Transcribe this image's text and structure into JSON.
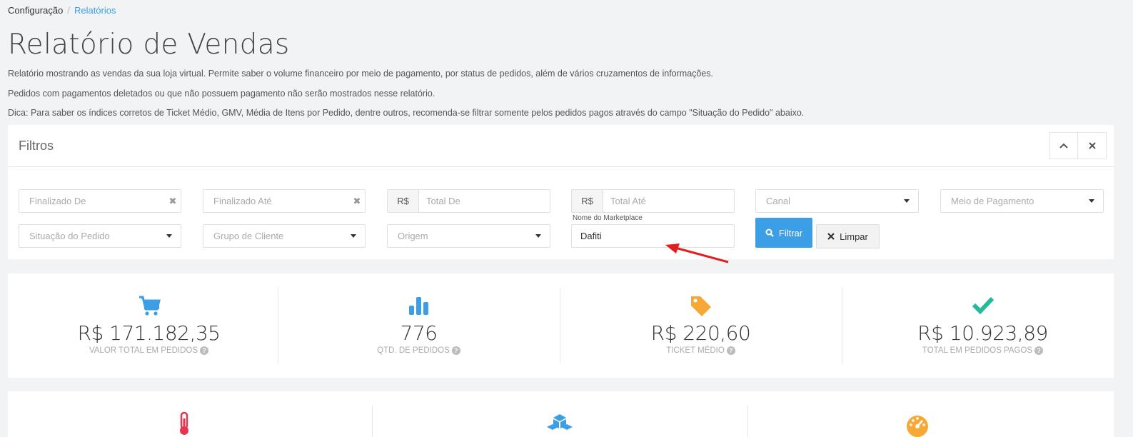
{
  "breadcrumb": {
    "home": "Configuração",
    "separator": "/",
    "current": "Relatórios"
  },
  "page": {
    "title": "Relatório de Vendas",
    "desc1": "Relatório mostrando as vendas da sua loja virtual. Permite saber o volume financeiro por meio de pagamento, por status de pedidos, além de vários cruzamentos de informações.",
    "desc2": "Pedidos com pagamentos deletados ou que não possuem pagamento não serão mostrados nesse relatório.",
    "desc3": "Dica: Para saber os índices corretos de Ticket Médio, GMV, Média de Itens por Pedido, dentre outros, recomenda-se filtrar somente pelos pedidos pagos através do campo \"Situação do Pedido\" abaixo."
  },
  "filters": {
    "title": "Filtros",
    "finalizado_de": "Finalizado De",
    "finalizado_ate": "Finalizado Até",
    "currency": "R$",
    "total_de": "Total De",
    "total_ate": "Total Até",
    "canal": "Canal",
    "meio_pagamento": "Meio de Pagamento",
    "situacao": "Situação do Pedido",
    "grupo_cliente": "Grupo de Cliente",
    "origem": "Origem",
    "marketplace_label": "Nome do Marketplace",
    "marketplace_value": "Dafiti",
    "btn_filtrar": "Filtrar",
    "btn_limpar": "Limpar"
  },
  "stats": [
    {
      "value": "R$ 171.182,35",
      "label": "VALOR TOTAL EM PEDIDOS",
      "icon": "cart-icon",
      "color": "#3c9ee5"
    },
    {
      "value": "776",
      "label": "QTD. DE PEDIDOS",
      "icon": "bar-chart-icon",
      "color": "#3c9ee5"
    },
    {
      "value": "R$ 220,60",
      "label": "TICKET MÉDIO",
      "icon": "tag-icon",
      "color": "#f7a836"
    },
    {
      "value": "R$ 10.923,89",
      "label": "TOTAL EM PEDIDOS PAGOS",
      "icon": "check-icon",
      "color": "#26b99a"
    }
  ],
  "stats2_icons": [
    {
      "icon": "thermometer-icon",
      "color": "#e8344e"
    },
    {
      "icon": "cubes-icon",
      "color": "#3c9ee5"
    },
    {
      "icon": "dashboard-icon",
      "color": "#f7a836"
    }
  ]
}
